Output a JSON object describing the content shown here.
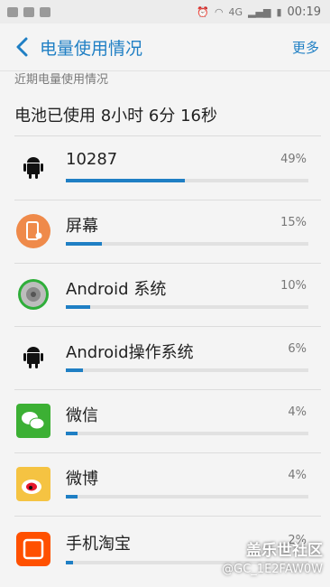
{
  "status_bar": {
    "time": "00:19",
    "network": "4G"
  },
  "header": {
    "title": "电量使用情况",
    "more": "更多"
  },
  "section_label": "近期电量使用情况",
  "summary": "电池已使用 8小时 6分 16秒",
  "apps": [
    {
      "name": "10287",
      "percent": "49%",
      "level": 0.49,
      "icon": "android-icon"
    },
    {
      "name": "屏幕",
      "percent": "15%",
      "level": 0.15,
      "icon": "screen-icon"
    },
    {
      "name": "Android 系统",
      "percent": "10%",
      "level": 0.1,
      "icon": "android-system-icon"
    },
    {
      "name": "Android操作系统",
      "percent": "6%",
      "level": 0.07,
      "icon": "android-icon"
    },
    {
      "name": "微信",
      "percent": "4%",
      "level": 0.05,
      "icon": "wechat-icon"
    },
    {
      "name": "微博",
      "percent": "4%",
      "level": 0.05,
      "icon": "weibo-icon"
    },
    {
      "name": "手机淘宝",
      "percent": "2%",
      "level": 0.03,
      "icon": "taobao-icon"
    }
  ],
  "watermark": {
    "line1": "盖乐世社区",
    "line2": "@GC_1E2FAW0W"
  },
  "colors": {
    "accent": "#1f7fc4",
    "bar_track": "#e1e1e1"
  }
}
